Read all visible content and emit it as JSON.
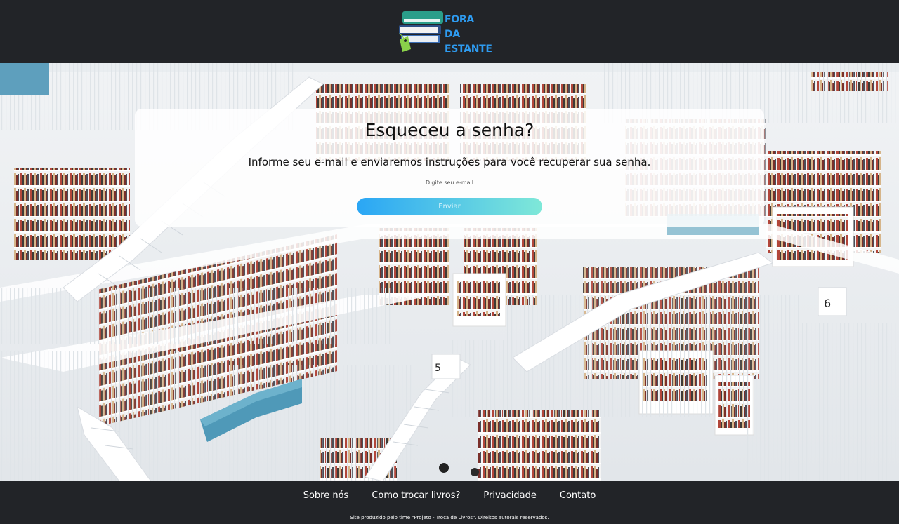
{
  "header": {
    "logo_line1": "FORA",
    "logo_line2": "DA ESTANTE"
  },
  "card": {
    "title": "Esqueceu a senha?",
    "subtitle": "Informe seu e-mail e enviaremos instruções para você recuperar sua senha.",
    "email_placeholder": "Digite seu e-mail",
    "email_value": "",
    "send_label": "Enviar"
  },
  "footer": {
    "links": [
      "Sobre nós",
      "Como trocar livros?",
      "Privacidade",
      "Contato"
    ],
    "note": "Site produzido pelo time \"Projeto - Troca de Livros\". Direitos autorais reservados."
  },
  "colors": {
    "header_bg": "#222428",
    "logo_blue": "#2e9bf0",
    "button_gradient_start": "#2aa6f5",
    "button_gradient_end": "#7fe8d8"
  },
  "icons": {
    "logo": "books-stack-with-price-tag-icon"
  }
}
